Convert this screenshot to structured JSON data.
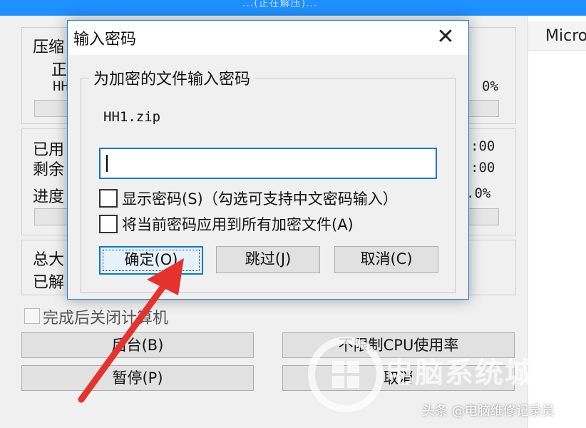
{
  "background_window": {
    "title_fragment": "...(正在解压)...",
    "left_edge_char": "H",
    "right_pane_header": "Micro",
    "compress_label": "压缩",
    "status_label": "正",
    "file_label": "HH",
    "percent_top": "0%",
    "elapsed_label": "已用",
    "remaining_label": "剩余",
    "elapsed_value": ":00",
    "remaining_value": ":00",
    "progress_label": "进度",
    "progress_value": ".0%",
    "total_size_label": "总大",
    "extracted_label": "已解",
    "shutdown_checkbox_label": "完成后关闭计算机",
    "background_button": "后台(B)",
    "pause_button": "暂停(P)",
    "cpu_limit_button": "不限制CPU使用率",
    "cancel_button": "取消"
  },
  "dialog": {
    "title": "输入密码",
    "close_glyph": "✕",
    "group_label": "为加密的文件输入密码",
    "filename": "HH1.zip",
    "password_value": "",
    "show_password_label": "显示密码(S)（勾选可支持中文密码输入）",
    "apply_all_label": "将当前密码应用到所有加密文件(A)",
    "ok_button": "确定(O)",
    "skip_button": "跳过(J)",
    "cancel_button": "取消(C)"
  },
  "watermark": {
    "site_text": "电脑系统城",
    "credit": "头条 @电脑维修记录员"
  },
  "colors": {
    "accent": "#0078d7",
    "arrow": "#e5322d"
  },
  "icons": {
    "close": "close-icon",
    "arrow": "red-arrow-annotation"
  }
}
